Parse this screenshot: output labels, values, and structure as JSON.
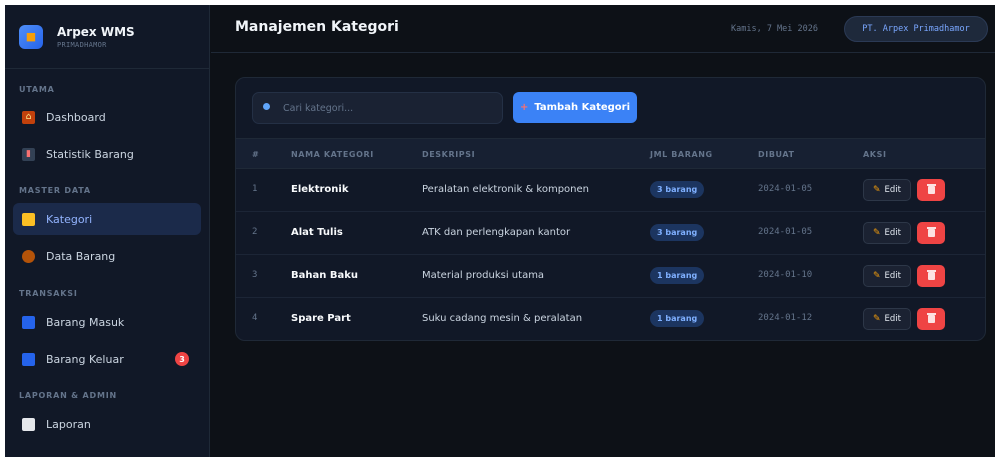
{
  "brand": {
    "title": "Arpex WMS",
    "subtitle": "PRIMADHAMOR",
    "logo_icon": "box-icon"
  },
  "sidebar": {
    "sections": [
      {
        "label": "UTAMA"
      },
      {
        "label": "MASTER DATA"
      },
      {
        "label": "TRANSAKSI"
      },
      {
        "label": "LAPORAN & ADMIN"
      }
    ],
    "items": [
      {
        "label": "Dashboard",
        "icon": "home-icon",
        "active": false
      },
      {
        "label": "Statistik Barang",
        "icon": "chart-icon",
        "active": false
      },
      {
        "label": "Kategori",
        "icon": "folder-icon",
        "active": true
      },
      {
        "label": "Data Barang",
        "icon": "box-icon",
        "active": false
      },
      {
        "label": "Barang Masuk",
        "icon": "inbox-in-icon",
        "active": false
      },
      {
        "label": "Barang Keluar",
        "icon": "inbox-out-icon",
        "active": false,
        "badge": "3"
      },
      {
        "label": "Laporan",
        "icon": "clipboard-icon",
        "active": false
      }
    ]
  },
  "header": {
    "title": "Manajemen Kategori",
    "date": "Kamis, 7 Mei 2026",
    "company": "PT. Arpex Primadhamor"
  },
  "toolbar": {
    "search_placeholder": "Cari kategori...",
    "add_label": "Tambah Kategori",
    "add_icon": "plus-icon"
  },
  "table": {
    "columns": [
      "#",
      "NAMA KATEGORI",
      "DESKRIPSI",
      "JML BARANG",
      "DIBUAT",
      "AKSI"
    ],
    "rows": [
      {
        "no": "1",
        "name": "Elektronik",
        "desc": "Peralatan elektronik & komponen",
        "count": "3 barang",
        "created": "2024-01-05"
      },
      {
        "no": "2",
        "name": "Alat Tulis",
        "desc": "ATK dan perlengkapan kantor",
        "count": "3 barang",
        "created": "2024-01-05"
      },
      {
        "no": "3",
        "name": "Bahan Baku",
        "desc": "Material produksi utama",
        "count": "1 barang",
        "created": "2024-01-10"
      },
      {
        "no": "4",
        "name": "Spare Part",
        "desc": "Suku cadang mesin & peralatan",
        "count": "1 barang",
        "created": "2024-01-12"
      }
    ],
    "edit_label": "Edit"
  },
  "colors": {
    "accent": "#3b82f6",
    "danger": "#ef4444",
    "background": "#0d1117",
    "panel": "#111827"
  }
}
